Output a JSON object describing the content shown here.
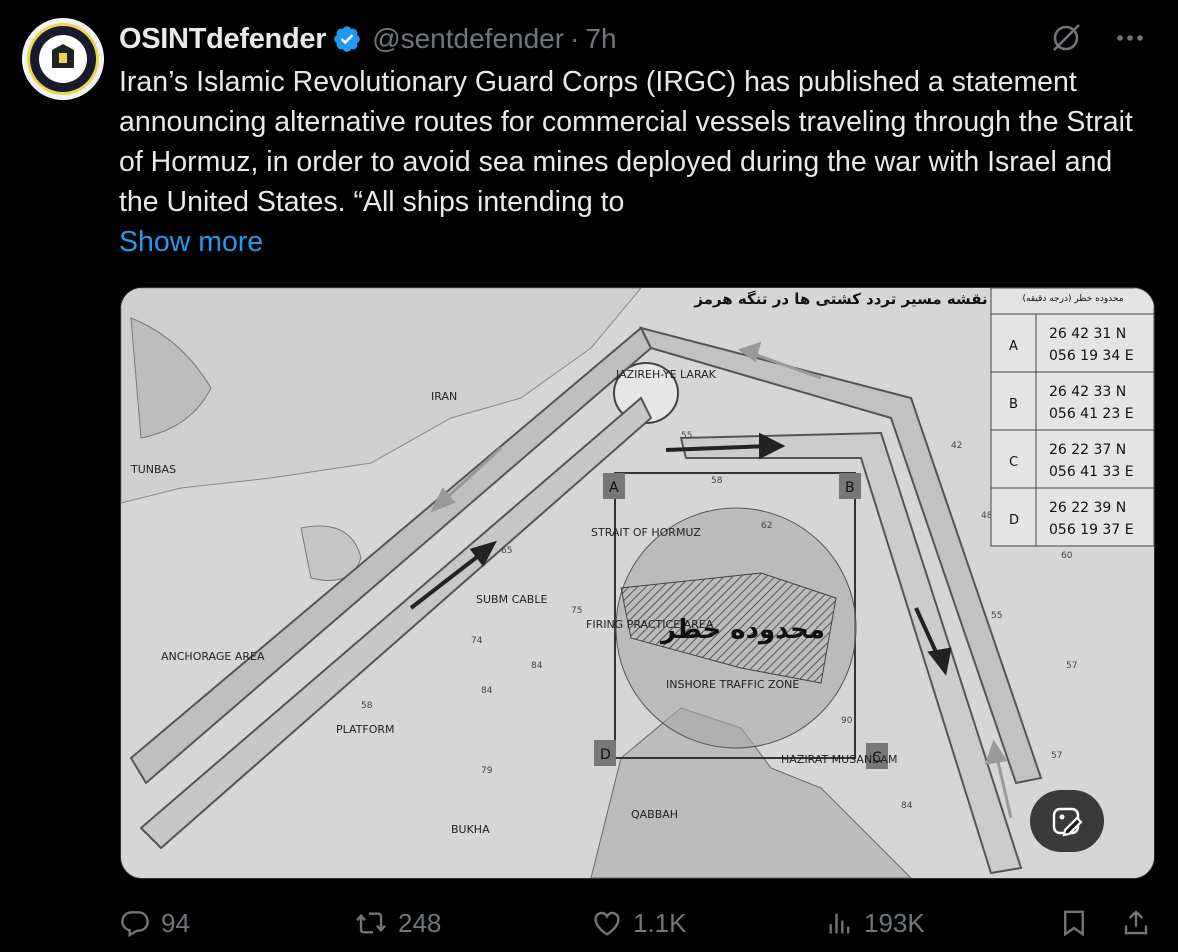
{
  "tweet": {
    "author_name": "OSINTdefender",
    "author_handle": "@sentdefender",
    "separator": "·",
    "time": "7h",
    "text": "Iran’s Islamic Revolutionary Guard Corps (IRGC) has published a statement announcing alternative routes for commercial vessels traveling through the Strait of Hormuz, in order to avoid sea mines deployed during the war with Israel and the United States. “All ships intending to",
    "show_more_label": "Show more",
    "verified_color": "#1d9bf0",
    "link_color": "#1d9bf0"
  },
  "icons": {
    "verified": "verified-badge-icon",
    "grok": "grok-icon",
    "more": "more-icon",
    "reply": "reply-icon",
    "retweet": "retweet-icon",
    "like": "like-icon",
    "views": "views-icon",
    "bookmark": "bookmark-icon",
    "share": "share-icon",
    "edit_image": "edit-image-icon"
  },
  "map": {
    "title_fa": "نقشه مسیر تردد کشتی ها در تنگه هرمز",
    "table_header_fa": "محدوده خطر (درجه دقیقه)",
    "danger_label_fa": "محدوده خطر",
    "labels": {
      "iran": "IRAN",
      "strait": "STRAIT OF HORMUZ",
      "subm_cable": "SUBM CABLE",
      "inshore": "INSHORE TRAFFIC ZONE",
      "larak": "JAZIREH-YE LARAK",
      "tunb": "TUNBAS",
      "firing": "FIRING PRACTICE AREA",
      "musandam": "HAZIRAT MUSANDAM",
      "bukha": "BUKHA",
      "qabbah": "QABBAH",
      "anchor": "ANCHORAGE AREA",
      "platform": "PLATFORM"
    },
    "points": [
      {
        "id": "A",
        "lat": "26 42 31 N",
        "lon": "056 19 34 E"
      },
      {
        "id": "B",
        "lat": "26 42 33 N",
        "lon": "056 41 23 E"
      },
      {
        "id": "C",
        "lat": "26 22 37 N",
        "lon": "056 41 33 E"
      },
      {
        "id": "D",
        "lat": "26 22 39 N",
        "lon": "056 19 37 E"
      }
    ]
  },
  "actions": {
    "replies": "94",
    "retweets": "248",
    "likes": "1.1K",
    "views": "193K"
  }
}
